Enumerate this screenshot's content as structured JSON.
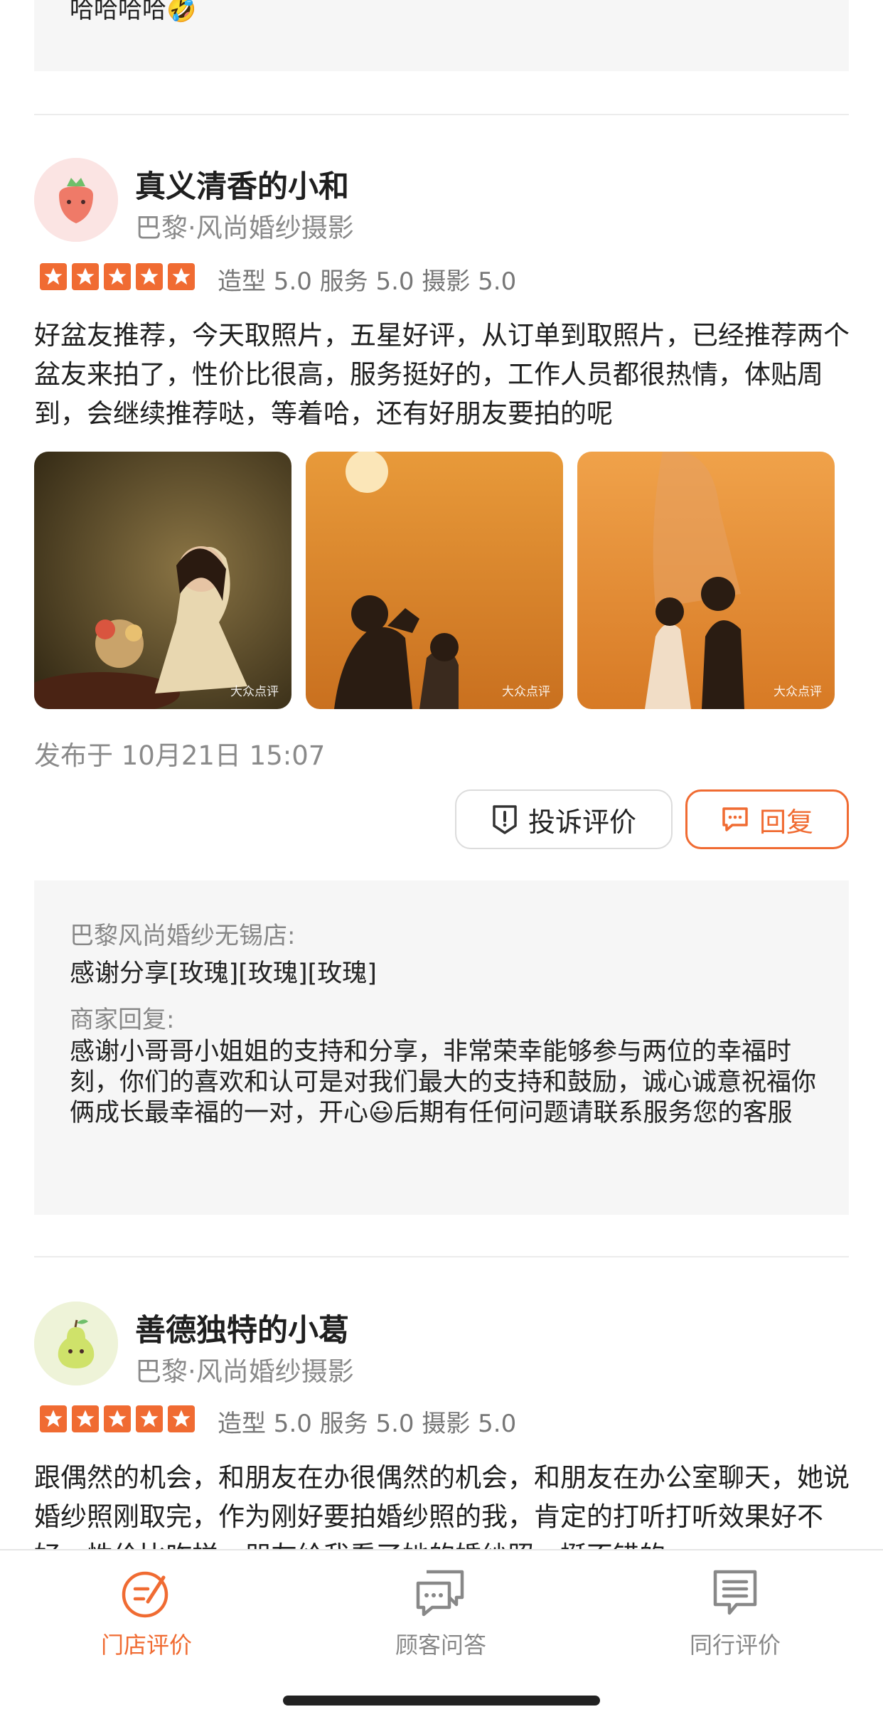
{
  "previous_review": {
    "text_tail": "哈哈哈哈",
    "emoji": "🤣"
  },
  "reviews": [
    {
      "user_name": "真义清香的小和",
      "shop": "巴黎·风尚婚纱摄影",
      "rating": 5,
      "scores": "造型 5.0 服务 5.0 摄影 5.0",
      "text": "好盆友推荐，今天取照片，五星好评，从订单到取照片，已经推荐两个盆友来拍了，性价比很高，服务挺好的，工作人员都很热情，体贴周到，会继续推荐哒，等着哈，还有好朋友要拍的呢",
      "photos": [
        {
          "watermark": "大众点评",
          "icon": "woman-portrait-photo"
        },
        {
          "watermark": "大众点评",
          "icon": "couple-heart-sunset-photo"
        },
        {
          "watermark": "大众点评",
          "icon": "couple-kiss-sunset-photo"
        }
      ],
      "post_time": "发布于 10月21日 15:07",
      "actions": {
        "complain": "投诉评价",
        "reply": "回复"
      },
      "merchant_reply": {
        "shop_line": "巴黎风尚婚纱无锡店:",
        "thanks": "感谢分享[玫瑰][玫瑰][玫瑰]",
        "label": "商家回复:",
        "text_part1": "感谢小哥哥小姐姐的支持和分享，非常荣幸能够参与两位的幸福时刻，你们的喜欢和认可是对我们最大的支持和鼓励，诚心诚意祝福你俩成长最幸福的一对，开心",
        "emoji": "😃",
        "text_part2": "后期有任何问题请联系服务您的客服"
      }
    },
    {
      "user_name": "善德独特的小葛",
      "shop": "巴黎·风尚婚纱摄影",
      "rating": 5,
      "scores": "造型 5.0 服务 5.0 摄影 5.0",
      "text": "跟偶然的机会，和朋友在办很偶然的机会，和朋友在办公室聊天，她说婚纱照刚取完，作为刚好要拍婚纱照的我，肯定的打听打听效果好不好，性价比咋样，朋友给我看了她的婚纱照，挺不错的"
    }
  ],
  "tabs": [
    {
      "label": "门店评价",
      "icon": "review-check-icon",
      "active": true
    },
    {
      "label": "顾客问答",
      "icon": "chat-bubbles-icon",
      "active": false
    },
    {
      "label": "同行评价",
      "icon": "list-doc-icon",
      "active": false
    }
  ],
  "colors": {
    "accent": "#f06b32",
    "muted": "#8a8a8a",
    "box_bg": "#f6f6f6"
  }
}
